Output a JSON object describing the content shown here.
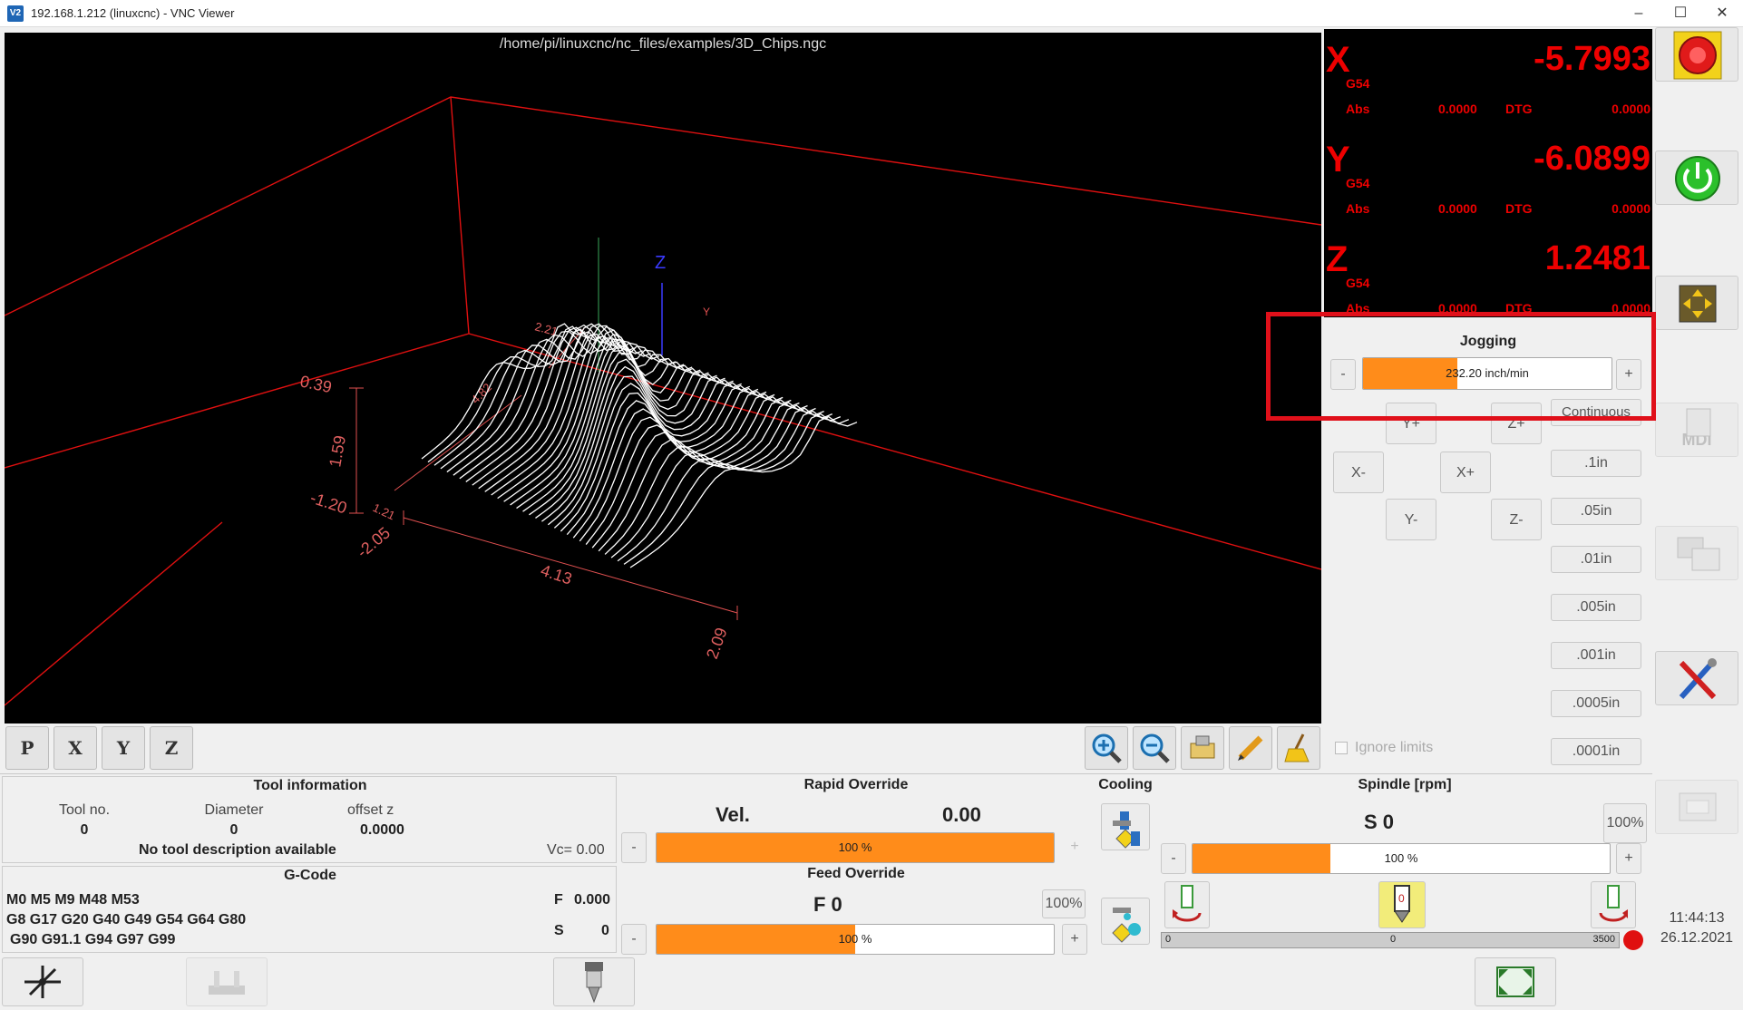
{
  "window": {
    "app_icon": "V2",
    "title": "192.168.1.212 (linuxcnc) - VNC Viewer",
    "minimize": "–",
    "maximize": "☐",
    "close": "✕"
  },
  "viewport": {
    "file_path": "/home/pi/linuxcnc/nc_files/examples/3D_Chips.ngc",
    "dims": {
      "top": "0.39",
      "height": "1.59",
      "lower": "-1.20",
      "x_neg": "-2.05",
      "width": "4.13",
      "depth": "2.09",
      "y_back": "2.21",
      "side": "4.82",
      "mid": "1.21"
    },
    "axis_z": "Z",
    "axis_y": "Y",
    "view_buttons": [
      "P",
      "X",
      "Y",
      "Z"
    ]
  },
  "dro": {
    "axes": [
      {
        "name": "X",
        "wcs": "G54",
        "value": "-5.7993",
        "abs_label": "Abs",
        "abs": "0.0000",
        "dtg_label": "DTG",
        "dtg": "0.0000"
      },
      {
        "name": "Y",
        "wcs": "G54",
        "value": "-6.0899",
        "abs_label": "Abs",
        "abs": "0.0000",
        "dtg_label": "DTG",
        "dtg": "0.0000"
      },
      {
        "name": "Z",
        "wcs": "G54",
        "value": "1.2481",
        "abs_label": "Abs",
        "abs": "0.0000",
        "dtg_label": "DTG",
        "dtg": "0.0000"
      }
    ]
  },
  "jogging": {
    "title": "Jogging",
    "minus": "-",
    "plus": "+",
    "rate": "232.20 inch/min",
    "rate_fill_pct": 38,
    "continuous": "Continuous",
    "buttons": {
      "y_plus": "Y+",
      "z_plus": "Z+",
      "x_minus": "X-",
      "x_plus": "X+",
      "y_minus": "Y-",
      "z_minus": "Z-"
    },
    "increments": [
      ".1in",
      ".05in",
      ".01in",
      ".005in",
      ".001in",
      ".0005in",
      ".0001in"
    ],
    "ignore_limits": "Ignore limits"
  },
  "side_toolbar": {
    "mdi": "MDI"
  },
  "tool": {
    "title": "Tool information",
    "tool_no_label": "Tool no.",
    "tool_no": "0",
    "diameter_label": "Diameter",
    "diameter": "0",
    "offset_label": "offset z",
    "offset": "0.0000",
    "description": "No tool description available",
    "vc": "Vc= 0.00"
  },
  "gcode": {
    "title": "G-Code",
    "lines": [
      "M0 M5 M9 M48 M53",
      "G8 G17 G20 G40 G49 G54 G64 G80",
      "G90 G91.1 G94 G97 G99"
    ],
    "f_label": "F",
    "f_value": "0.000",
    "s_label": "S",
    "s_value": "0"
  },
  "rapid": {
    "title": "Rapid Override",
    "vel_label": "Vel.",
    "vel_value": "0.00",
    "minus": "-",
    "plus": "+",
    "bar_text": "100 %",
    "fill_pct": 100
  },
  "feed": {
    "title": "Feed Override",
    "f_text": "F  0",
    "pct_button": "100%",
    "minus": "-",
    "plus": "+",
    "bar_text": "100 %",
    "fill_pct": 50
  },
  "cooling": {
    "title": "Cooling"
  },
  "spindle": {
    "title": "Spindle [rpm]",
    "s_text": "S 0",
    "pct_button": "100%",
    "minus": "-",
    "plus": "+",
    "bar_text": "100 %",
    "fill_pct": 33,
    "rpm_min": "0",
    "rpm_mid": "0",
    "rpm_max": "3500",
    "ccw_label": "",
    "stop_label": "0"
  },
  "clock": {
    "time": "11:44:13",
    "date": "26.12.2021"
  },
  "colors": {
    "accent_orange": "#ff8c1a",
    "dro_red": "#e00000",
    "highlight_box": "#e0101a"
  }
}
